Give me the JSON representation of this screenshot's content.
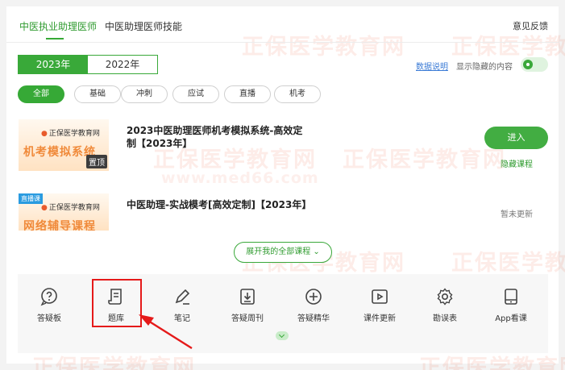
{
  "header": {
    "tabs": [
      {
        "label": "中医执业助理医师",
        "active": true
      },
      {
        "label": "中医助理医师技能",
        "active": false
      }
    ],
    "feedback_label": "意见反馈"
  },
  "years": {
    "items": [
      "2023年",
      "2022年"
    ],
    "selected": "2023年"
  },
  "options": {
    "data_note_label": "数据说明",
    "show_hidden_label": "显示隐藏的内容",
    "show_hidden_on": true
  },
  "filters": {
    "items": [
      "全部",
      "基础",
      "冲刺",
      "应试",
      "直播",
      "机考"
    ],
    "selected": "全部"
  },
  "courses": [
    {
      "title": "2023中医助理医师机考模拟系统-高效定制【2023年】",
      "thumb_logo": "正保医学教育网",
      "thumb_banner": "机考模拟系统",
      "thumb_badge": "置顶",
      "action_label": "进入",
      "secondary_label": "隐藏课程"
    },
    {
      "title": "中医助理-实战模考[高效定制]【2023年】",
      "thumb_logo": "正保医学教育网",
      "thumb_banner": "网络辅导课程",
      "thumb_tag": "直播课",
      "status_label": "暂未更新"
    }
  ],
  "expand_label": "展开我的全部课程",
  "tools": [
    {
      "label": "答疑板",
      "icon": "question-icon"
    },
    {
      "label": "题库",
      "icon": "question-bank-icon",
      "highlighted": true
    },
    {
      "label": "笔记",
      "icon": "pencil-icon"
    },
    {
      "label": "答疑周刊",
      "icon": "download-doc-icon"
    },
    {
      "label": "答疑精华",
      "icon": "plus-circle-icon"
    },
    {
      "label": "课件更新",
      "icon": "play-icon"
    },
    {
      "label": "勘误表",
      "icon": "gear-icon"
    },
    {
      "label": "App看课",
      "icon": "tablet-icon"
    }
  ],
  "watermark": {
    "text": "正保医学教育网",
    "url": "www.med66.com"
  },
  "colors": {
    "brand_green": "#36a936",
    "highlight_red": "#e51a1a",
    "link_blue": "#3b7bd6"
  }
}
